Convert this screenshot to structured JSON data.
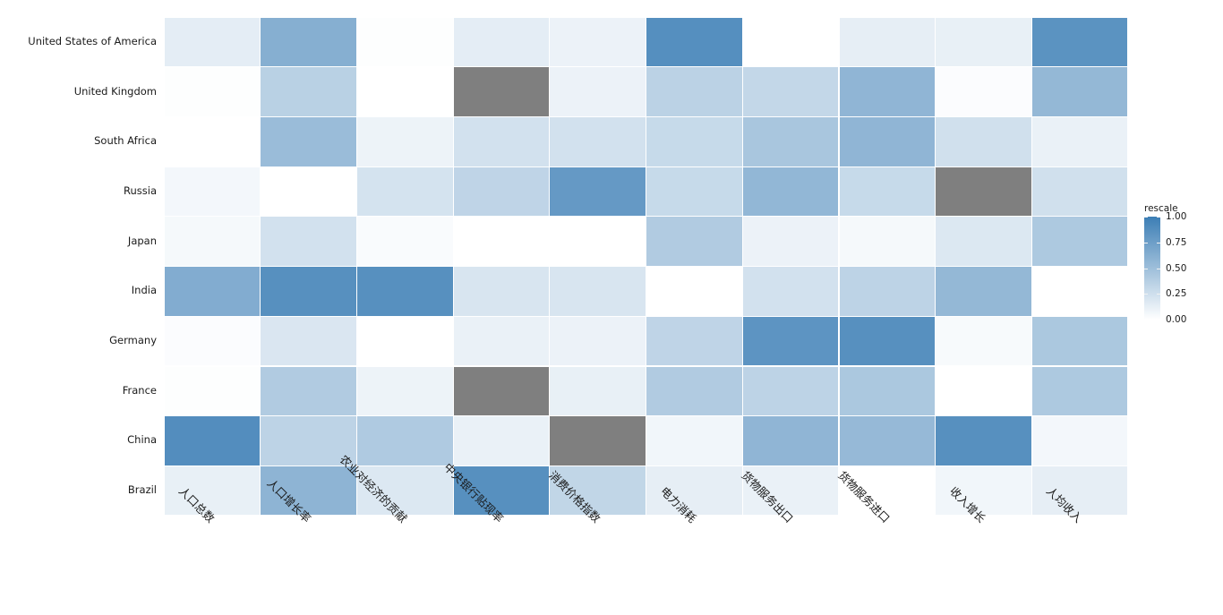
{
  "chart_data": {
    "type": "heatmap",
    "title": "",
    "xlabel": "",
    "ylabel": "",
    "grid": false,
    "legend_position": "right",
    "legend": {
      "title": "rescale",
      "ticks": [
        "1.00",
        "0.75",
        "0.50",
        "0.25",
        "0.00"
      ],
      "tick_values": [
        1.0,
        0.75,
        0.5,
        0.25,
        0.0
      ],
      "range": [
        0.0,
        1.0
      ],
      "low_color": "#FFFFFF",
      "high_color": "#3C7EB5",
      "na_color": "#7F7F7F"
    },
    "categories": [
      "人口总数",
      "人口增长率",
      "农业对经济的贡献",
      "中央银行贴现率",
      "消费价格指数",
      "电力消耗",
      "货物服务出口",
      "货物服务进口",
      "收入增长",
      "人均收入"
    ],
    "rows": [
      "United States of America",
      "United Kingdom",
      "South Africa",
      "Russia",
      "Japan",
      "India",
      "Germany",
      "France",
      "China",
      "Brazil"
    ],
    "values": [
      [
        0.14,
        0.62,
        0.01,
        0.14,
        0.1,
        0.87,
        0.0,
        0.13,
        0.12,
        0.84
      ],
      [
        0.01,
        0.36,
        0.0,
        null,
        0.1,
        0.35,
        0.31,
        0.57,
        0.02,
        0.55
      ],
      [
        0.0,
        0.52,
        0.09,
        0.23,
        0.23,
        0.29,
        0.44,
        0.57,
        0.24,
        0.11
      ],
      [
        0.06,
        0.0,
        0.22,
        0.33,
        0.79,
        0.29,
        0.56,
        0.29,
        null,
        0.24
      ],
      [
        0.05,
        0.23,
        0.03,
        0.0,
        0.0,
        0.4,
        0.1,
        0.05,
        0.18,
        0.42
      ],
      [
        0.64,
        0.86,
        0.86,
        0.2,
        0.2,
        0.0,
        0.23,
        0.34,
        0.55,
        0.0
      ],
      [
        0.02,
        0.19,
        0.0,
        0.11,
        0.1,
        0.33,
        0.83,
        0.86,
        0.04,
        0.43
      ],
      [
        0.01,
        0.4,
        0.09,
        null,
        0.12,
        0.4,
        0.34,
        0.43,
        0.0,
        0.42
      ],
      [
        0.88,
        0.34,
        0.41,
        0.11,
        null,
        0.07,
        0.57,
        0.54,
        0.86,
        0.06
      ],
      [
        0.12,
        0.58,
        0.18,
        0.86,
        0.32,
        0.13,
        0.11,
        0.0,
        0.07,
        0.13
      ]
    ]
  }
}
